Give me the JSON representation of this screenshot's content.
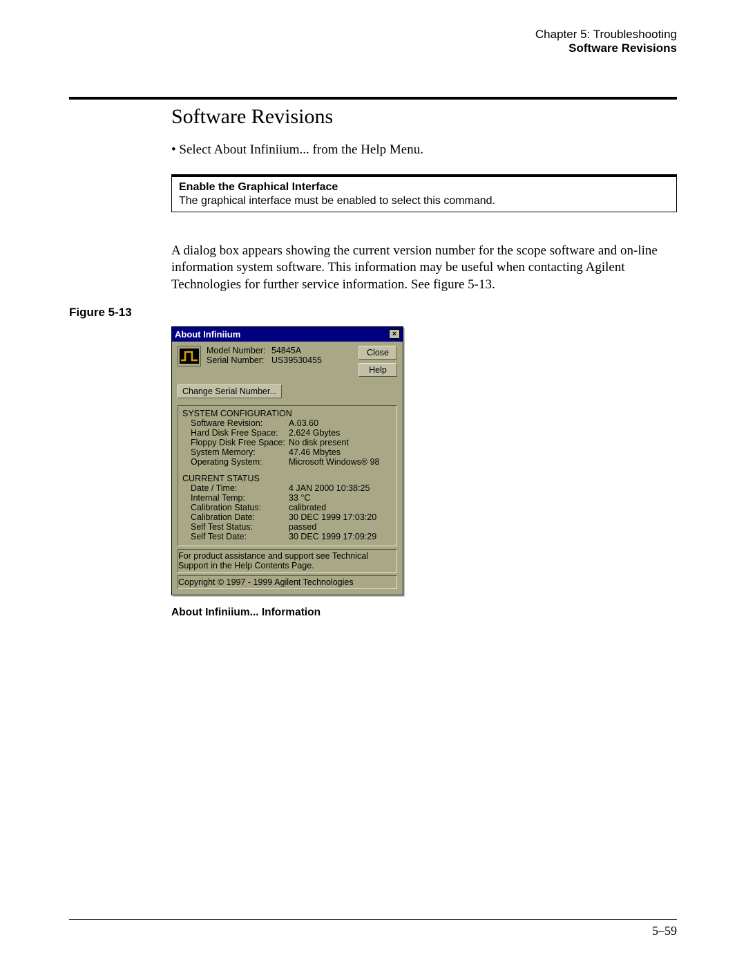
{
  "header": {
    "chapter": "Chapter 5: Troubleshooting",
    "section": "Software Revisions"
  },
  "title": "Software Revisions",
  "bullet": "• Select About Infiniium... from the Help Menu.",
  "note": {
    "title": "Enable the Graphical Interface",
    "body": "The graphical interface must be enabled to select this command."
  },
  "paragraph": "A dialog box appears showing the current version number for the scope software and on-line information system software. This information may be useful when contacting Agilent Technologies for further service information. See figure 5-13.",
  "figure_label": "Figure 5-13",
  "figure_caption": "About Infiniium... Information",
  "dialog": {
    "title": "About Infiniium",
    "close_icon": "×",
    "buttons": {
      "close": "Close",
      "help": "Help"
    },
    "model_label": "Model Number:",
    "model_value": "54845A",
    "serial_label": "Serial  Number:",
    "serial_value": "US39530455",
    "change_serial": "Change Serial Number...",
    "sys_config_heading": "SYSTEM CONFIGURATION",
    "sys_config": [
      {
        "k": "Software Revision:",
        "v": "A.03.60"
      },
      {
        "k": "Hard Disk Free Space:",
        "v": "2.624 Gbytes"
      },
      {
        "k": "Floppy Disk Free Space:",
        "v": "No disk present"
      },
      {
        "k": "System Memory:",
        "v": "47.46 Mbytes"
      },
      {
        "k": "Operating System:",
        "v": "Microsoft Windows® 98"
      }
    ],
    "current_status_heading": "CURRENT STATUS",
    "current_status": [
      {
        "k": "Date / Time:",
        "v": "4 JAN 2000 10:38:25"
      },
      {
        "k": "Internal Temp:",
        "v": "33 °C"
      },
      {
        "k": "Calibration Status:",
        "v": "calibrated"
      },
      {
        "k": "Calibration Date:",
        "v": "30 DEC 1999 17:03:20"
      },
      {
        "k": "Self Test Status:",
        "v": "passed"
      },
      {
        "k": "Self Test Date:",
        "v": "30 DEC 1999 17:09:29"
      }
    ],
    "support_text": "For product assistance and support see Technical Support in the Help Contents Page.",
    "copyright": "Copyright © 1997 - 1999 Agilent Technologies"
  },
  "page_number": "5–59"
}
